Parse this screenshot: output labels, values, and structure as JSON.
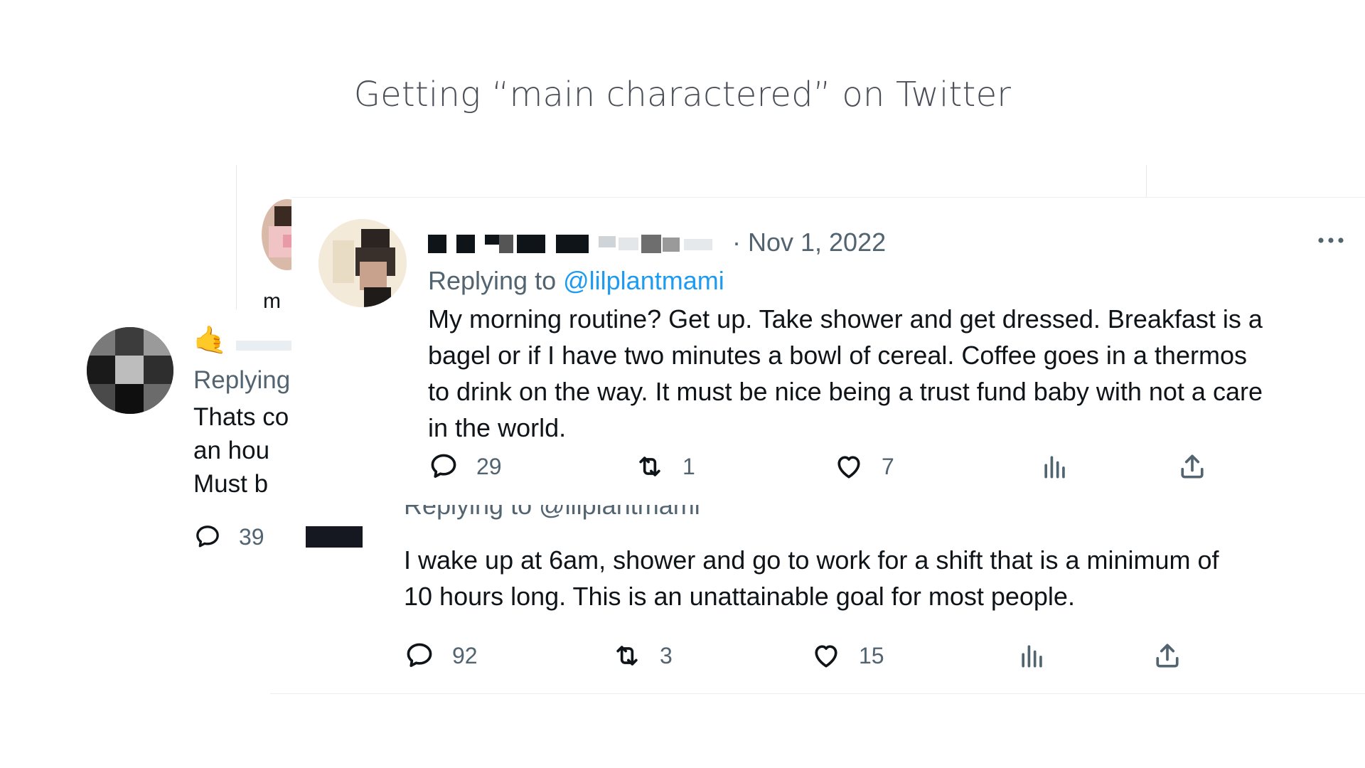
{
  "slide": {
    "title": "Getting “main charactered” on Twitter"
  },
  "back_tweet_left": {
    "replying_label": "Replying",
    "text_lines": [
      "Thats co",
      "an hou",
      "Must b"
    ],
    "reply_count": "39"
  },
  "back_tweet_top": {
    "text_fragment": "m"
  },
  "main_tweet": {
    "date": "· Nov 1, 2022",
    "replying_prefix": "Replying to",
    "replying_handle": "@lilplantmami",
    "text": "My morning routine? Get up. Take shower and get dressed. Breakfast is a bagel or if I have two minutes a bowl of cereal. Coffee goes in a thermos to drink on the way. It must be nice being a trust fund baby with not a care in  the world.",
    "text_lines": [
      "My morning routine? Get up. Take shower and get dressed. Breakfast is a",
      "bagel or if I have two minutes a bowl of cereal. Coffee goes in a thermos",
      "to drink on the way. It must be nice being a trust fund baby with not a care",
      "in  the world."
    ],
    "actions": {
      "replies": "29",
      "retweets": "1",
      "likes": "7"
    }
  },
  "bottom_tweet": {
    "replying_fragment": "Replying to @lilplantmami",
    "text_lines": [
      "I wake up at 6am, shower and go to work for a shift that is a minimum of",
      "10 hours long. This is an unattainable goal for most people."
    ],
    "actions": {
      "replies": "92",
      "retweets": "3",
      "likes": "15"
    }
  },
  "icons": {
    "reply": "speech-bubble-icon",
    "retweet": "retweet-icon",
    "like": "heart-icon",
    "views": "bar-chart-icon",
    "share": "share-upload-icon",
    "more": "more-dots-icon",
    "emoji": "call-me-hand-emoji"
  },
  "colors": {
    "link": "#1d9bf0",
    "muted": "#536471",
    "text": "#0f1419",
    "title": "#4b4f58"
  }
}
